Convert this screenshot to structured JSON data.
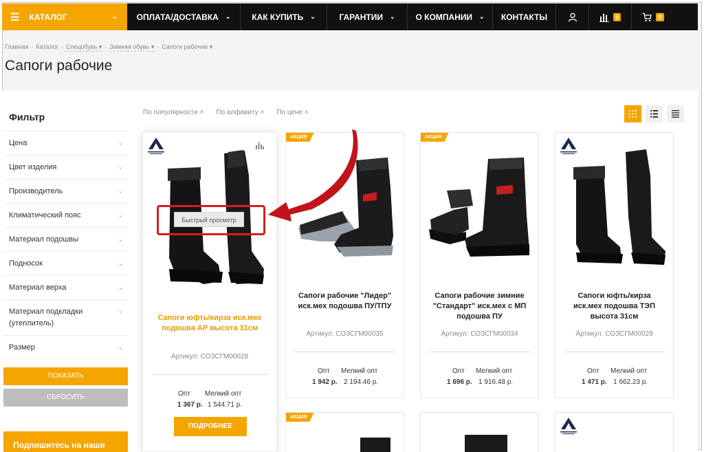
{
  "nav": {
    "catalog": "КАТАЛОГ",
    "items": [
      "ОПЛАТА/ДОСТАВКА",
      "КАК КУПИТЬ",
      "ГАРАНТИИ",
      "О КОМПАНИИ",
      "КОНТАКТЫ"
    ],
    "compare_count": "0",
    "cart_count": "0",
    "user_icon": "user-icon",
    "compare_icon": "bar-chart-icon",
    "cart_icon": "cart-icon"
  },
  "breadcrumb": [
    "Главная",
    "Каталог",
    "Спецобувь",
    "Зимняя обувь",
    "Сапоги рабочие"
  ],
  "page_title": "Сапоги рабочие",
  "sidebar": {
    "title": "Фильтр",
    "filters": [
      "Цена",
      "Цвет изделия",
      "Производитель",
      "Климатический пояс",
      "Материал подошвы",
      "Подносок",
      "Материал верха",
      "Материал подкладки (утеплитель)",
      "Размер"
    ],
    "show_label": "ПОКАЗАТЬ",
    "reset_label": "СБРОСИТЬ",
    "subscribe_label": "Подпишитесь на наши"
  },
  "sort": [
    "По популярности",
    "По алфавиту",
    "По цене"
  ],
  "colors": {
    "accent": "#f5a500",
    "dark": "#111111",
    "highlight": "#d51d1d"
  },
  "products": [
    {
      "name": "Сапоги юфть/кирза иск.мех подошва АР высота 31см",
      "sku": "Артикул: СОЗСГМ00028",
      "opt_label": "Опт",
      "small_opt_label": "Мелкий опт",
      "opt_price": "1 367 р.",
      "small_opt_price": "1 544.71 р.",
      "more_label": "ПОДРОБНЕЕ",
      "quick_view": "Быстрый просмотр"
    },
    {
      "tag": "АКЦИЯ",
      "name": "Сапоги рабочие \"Лидер\" иск.мех подошва ПУ/ТПУ",
      "sku": "Артикул: СОЗСГМ00035",
      "opt_label": "Опт",
      "small_opt_label": "Мелкий опт",
      "opt_price": "1 942 р.",
      "small_opt_price": "2 194.46 р."
    },
    {
      "tag": "АКЦИЯ",
      "name": "Сапоги рабочие зимние \"Стандарт\" иск.мех с МП подошва ПУ",
      "sku": "Артикул: СОЗСГМ00034",
      "opt_label": "Опт",
      "small_opt_label": "Мелкий опт",
      "opt_price": "1 696 р.",
      "small_opt_price": "1 916.48 р."
    },
    {
      "name": "Сапоги юфть/кирза иск.мех подошва ТЭП высота 31см",
      "sku": "Артикул: СОЗСГМ00029",
      "opt_label": "Опт",
      "small_opt_label": "Мелкий опт",
      "opt_price": "1 471 р.",
      "small_opt_price": "1 662.23 р."
    }
  ],
  "row2_tags": [
    "АКЦИЯ"
  ]
}
